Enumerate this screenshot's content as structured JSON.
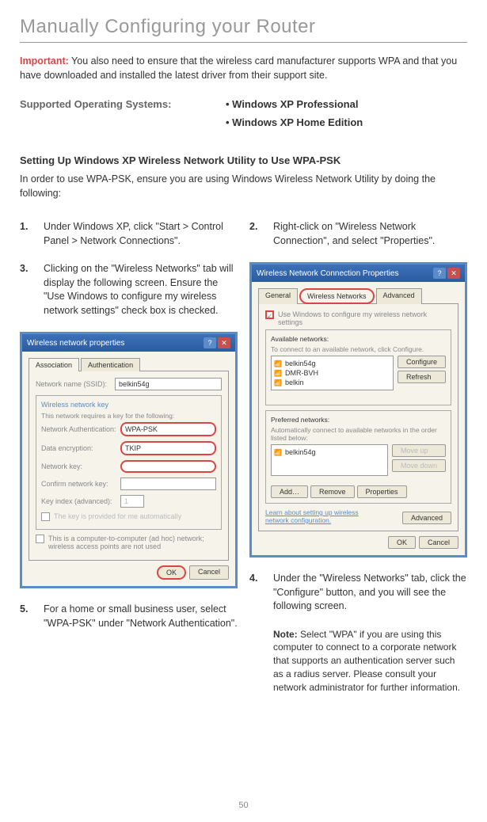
{
  "page_title": "Manually Configuring your Router",
  "important_label": "Important:",
  "important_text": " You also need to ensure that the wireless card manufacturer supports WPA and that you have downloaded and installed the latest driver from their support site.",
  "supported_os_label": "Supported Operating Systems:",
  "supported_os_items": [
    "• Windows XP Professional",
    "• Windows XP Home Edition"
  ],
  "section_heading": "Setting Up Windows XP Wireless Network Utility to Use WPA-PSK",
  "section_text": "In order to use WPA-PSK, ensure you are using Windows Wireless Network Utility by doing the following:",
  "steps": {
    "s1_num": "1.",
    "s1_text": "Under Windows XP, click \"Start > Control Panel > Network Connections\".",
    "s2_num": "2.",
    "s2_text": "Right-click on \"Wireless Network Connection\", and select \"Properties\".",
    "s3_num": "3.",
    "s3_text": "Clicking on the \"Wireless Networks\" tab will display the following screen. Ensure the \"Use Windows to configure my wireless network settings\" check box is checked.",
    "s4_num": "4.",
    "s4_text": "Under the \"Wireless Networks\" tab, click the \"Configure\" button, and you will see the following screen.",
    "s5_num": "5.",
    "s5_text": "For a home or small business user, select \"WPA-PSK\" under \"Network Authentication\"."
  },
  "note_label": "Note:",
  "note_text": " Select \"WPA\" if you are using this computer to connect to a corporate network that supports an authentication server such as a radius server. Please consult your network administrator for further information.",
  "page_num": "50",
  "dialog1": {
    "title": "Wireless network properties",
    "tab1": "Association",
    "tab2": "Authentication",
    "ssid_label": "Network name (SSID):",
    "ssid_value": "belkin54g",
    "key_group": "Wireless network key",
    "key_desc": "This network requires a key for the following:",
    "auth_label": "Network Authentication:",
    "auth_value": "WPA-PSK",
    "enc_label": "Data encryption:",
    "enc_value": "TKIP",
    "netkey_label": "Network key:",
    "confirm_label": "Confirm network key:",
    "keyindex_label": "Key index (advanced):",
    "keyindex_value": "1",
    "autokey": "The key is provided for me automatically",
    "adhoc": "This is a computer-to-computer (ad hoc) network; wireless access points are not used",
    "ok": "OK",
    "cancel": "Cancel"
  },
  "dialog2": {
    "title": "Wireless Network Connection Properties",
    "tab1": "General",
    "tab2": "Wireless Networks",
    "tab3": "Advanced",
    "use_windows": "Use Windows to configure my wireless network settings",
    "avail_label": "Available networks:",
    "avail_desc": "To connect to an available network, click Configure.",
    "avail_items": [
      "belkin54g",
      "DMR-BVH",
      "belkin"
    ],
    "configure": "Configure",
    "refresh": "Refresh",
    "pref_label": "Preferred networks:",
    "pref_desc": "Automatically connect to available networks in the order listed below:",
    "pref_items": [
      "belkin54g"
    ],
    "moveup": "Move up",
    "movedown": "Move down",
    "add": "Add…",
    "remove": "Remove",
    "properties": "Properties",
    "learn": "Learn about setting up wireless network configuration.",
    "advanced": "Advanced",
    "ok": "OK",
    "cancel": "Cancel"
  }
}
